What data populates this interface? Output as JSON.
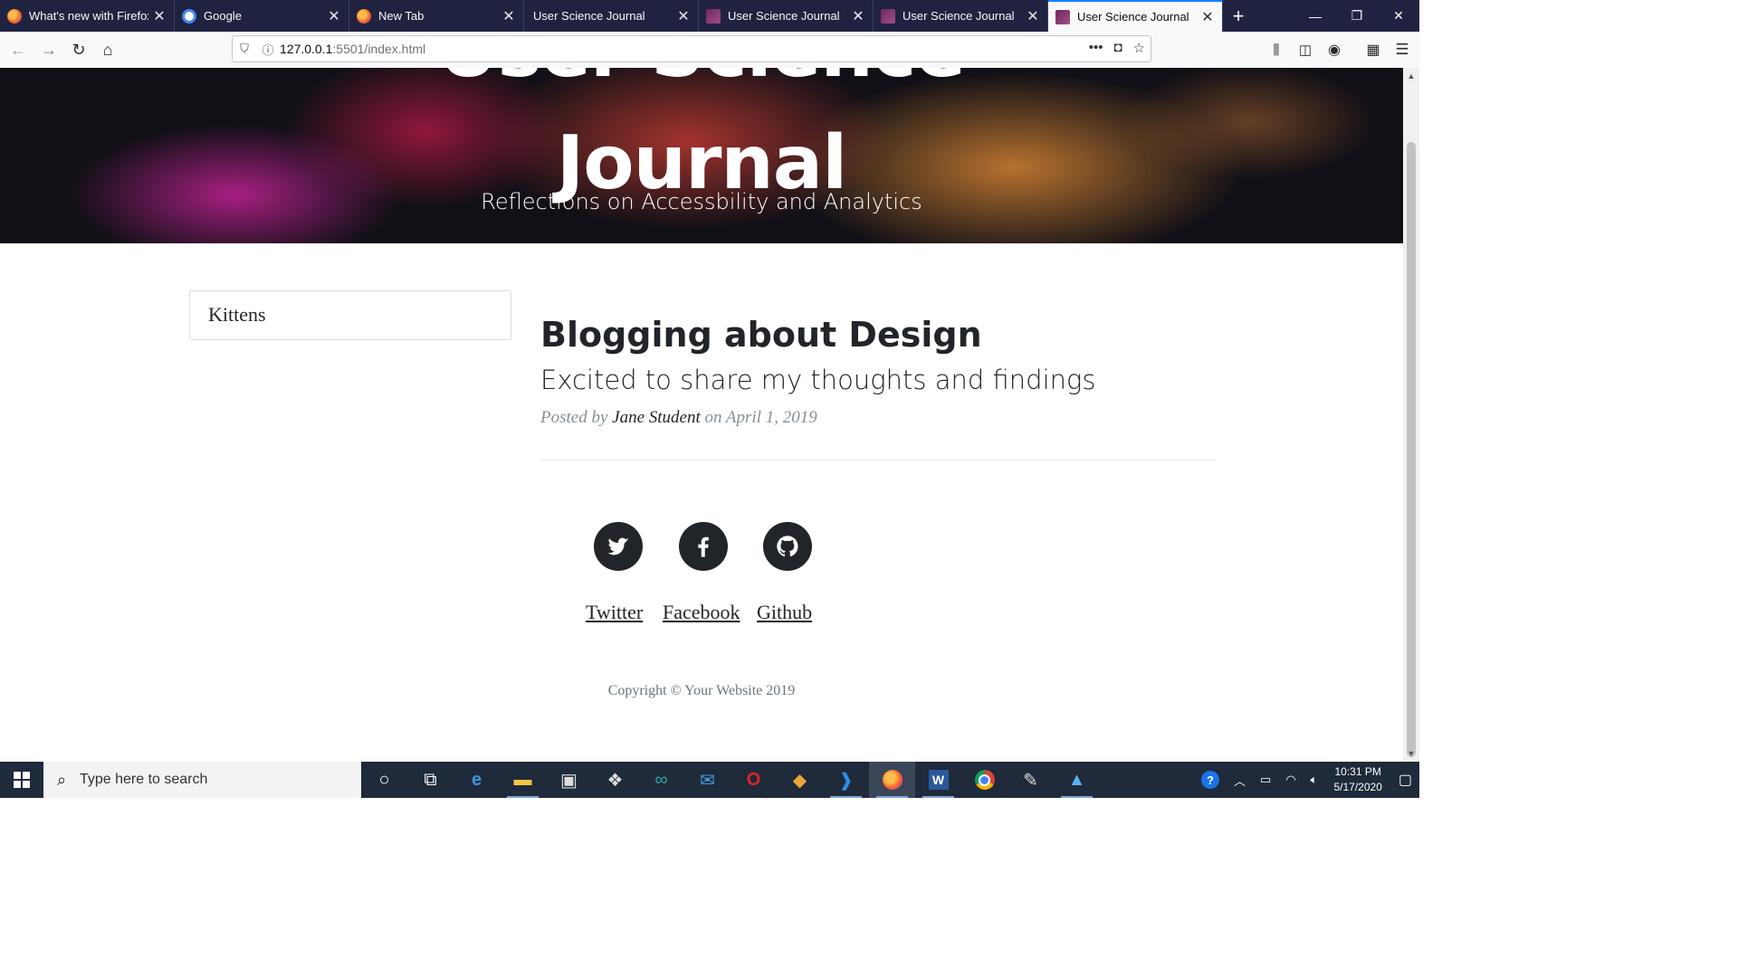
{
  "browser": {
    "tabs": [
      {
        "title": "What's new with Firefox",
        "icon": "firefox-icon",
        "active": false
      },
      {
        "title": "Google",
        "icon": "google-icon",
        "active": false
      },
      {
        "title": "New Tab",
        "icon": "firefox-icon",
        "active": false
      },
      {
        "title": "User Science Journal",
        "icon": "none",
        "active": false
      },
      {
        "title": "User Science Journal",
        "icon": "site-icon",
        "active": false
      },
      {
        "title": "User Science Journal",
        "icon": "site-icon",
        "active": false
      },
      {
        "title": "User Science Journal",
        "icon": "site-icon",
        "active": true
      }
    ],
    "url_host": "127.0.0.1",
    "url_path": ":5501/index.html"
  },
  "page": {
    "hero_title": "Journal",
    "hero_title_partial": "User Science",
    "hero_subtitle": "Reflections on Accessbility and Analytics",
    "sidebar_item": "Kittens",
    "post": {
      "title": "Blogging about Design",
      "subtitle": "Excited to share my thoughts and findings",
      "posted_by": "Posted by",
      "author": "Jane Student",
      "date": "on April 1, 2019"
    },
    "social": [
      {
        "label": "Twitter",
        "icon": "twitter-icon"
      },
      {
        "label": "Facebook",
        "icon": "facebook-icon"
      },
      {
        "label": "Github",
        "icon": "github-icon"
      }
    ],
    "copyright": "Copyright © Your Website 2019"
  },
  "taskbar": {
    "search_placeholder": "Type here to search",
    "time": "10:31 PM",
    "date": "5/17/2020",
    "apps": [
      "cortana-icon",
      "task-view-icon",
      "edge-icon",
      "file-explorer-icon",
      "store-icon",
      "dropbox-icon",
      "arduino-icon",
      "mail-icon",
      "opera-icon",
      "git-icon",
      "vscode-icon",
      "firefox-icon",
      "word-icon",
      "chrome-icon",
      "paint-icon",
      "photos-icon"
    ]
  },
  "colors": {
    "tabbar": "#202340",
    "accent": "#0a84ff",
    "text": "#212529",
    "muted": "#868e96"
  }
}
